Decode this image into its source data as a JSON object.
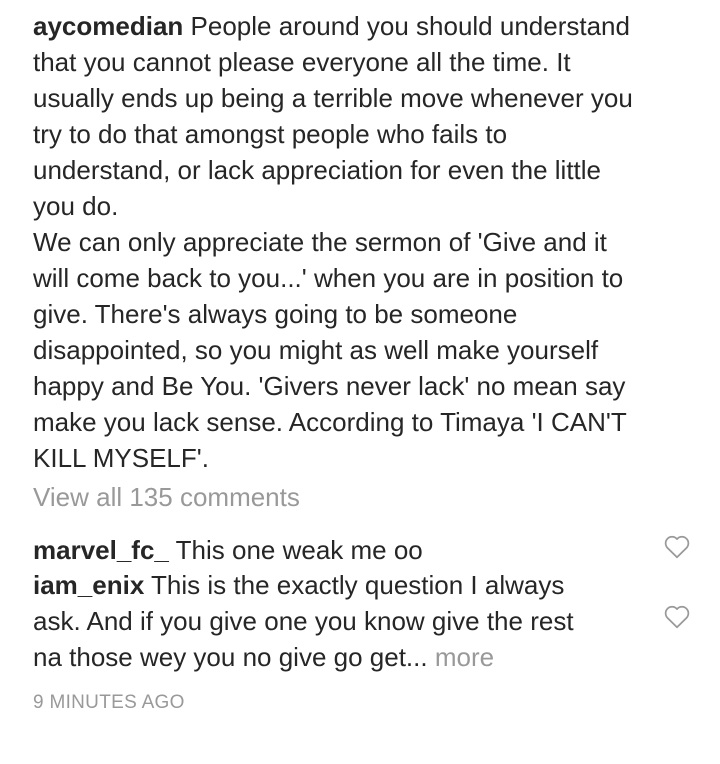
{
  "post": {
    "caption": {
      "username": "aycomedian",
      "text": " People around you should understand\nthat you cannot please everyone all the time. It\nusually ends up being a terrible move whenever you\ntry to do that amongst people who fails to\nunderstand, or lack appreciation for even the little\nyou do.\nWe can only appreciate the sermon of 'Give and it\nwill come back to you...' when you are in position to\ngive. There's always going to be someone\ndisappointed, so you might as well make yourself\nhappy and Be You. 'Givers never lack' no mean say\nmake you lack sense. According to Timaya 'I CAN'T\nKILL MYSELF'."
    },
    "view_all_label": "View all 135 comments",
    "comments": [
      {
        "username": "marvel_fc_",
        "text": " This one weak me oo",
        "more_label": ""
      },
      {
        "username": "iam_enix",
        "text": " This is the exactly question I always\nask. And if you give one you know give the rest\nna those wey you no give go get... ",
        "more_label": "more"
      }
    ],
    "like_icon": "heart-outline-icon",
    "timestamp": "9 MINUTES AGO"
  }
}
